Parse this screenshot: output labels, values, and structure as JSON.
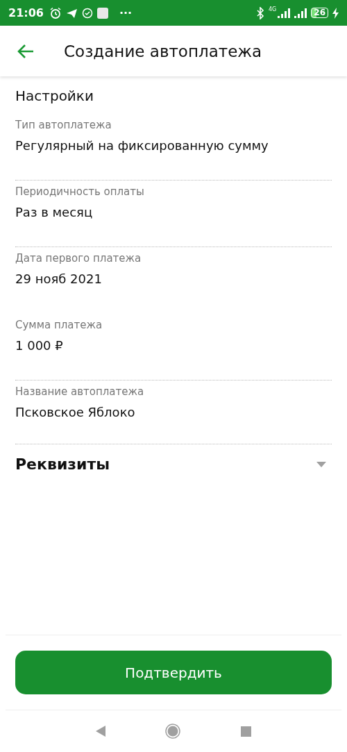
{
  "status_bar": {
    "time": "21:06",
    "more": "···",
    "network": "4G",
    "battery": "26"
  },
  "header": {
    "title": "Создание автоплатежа"
  },
  "section": {
    "title": "Настройки"
  },
  "fields": [
    {
      "label": "Тип автоплатежа",
      "value": "Регулярный на фиксированную сумму",
      "dotted": true
    },
    {
      "label": "Периодичность оплаты",
      "value": "Раз в месяц",
      "dotted": true
    },
    {
      "label": "Дата первого платежа",
      "value": "29 нояб 2021",
      "dotted": false
    },
    {
      "label": "Сумма платежа",
      "value": "1 000 ₽",
      "dotted": true
    },
    {
      "label": "Название автоплатежа",
      "value": "Псковское Яблоко",
      "dotted": true
    }
  ],
  "details": {
    "title": "Реквизиты",
    "expanded": false
  },
  "confirm_button": {
    "label": "Подтвердить"
  }
}
